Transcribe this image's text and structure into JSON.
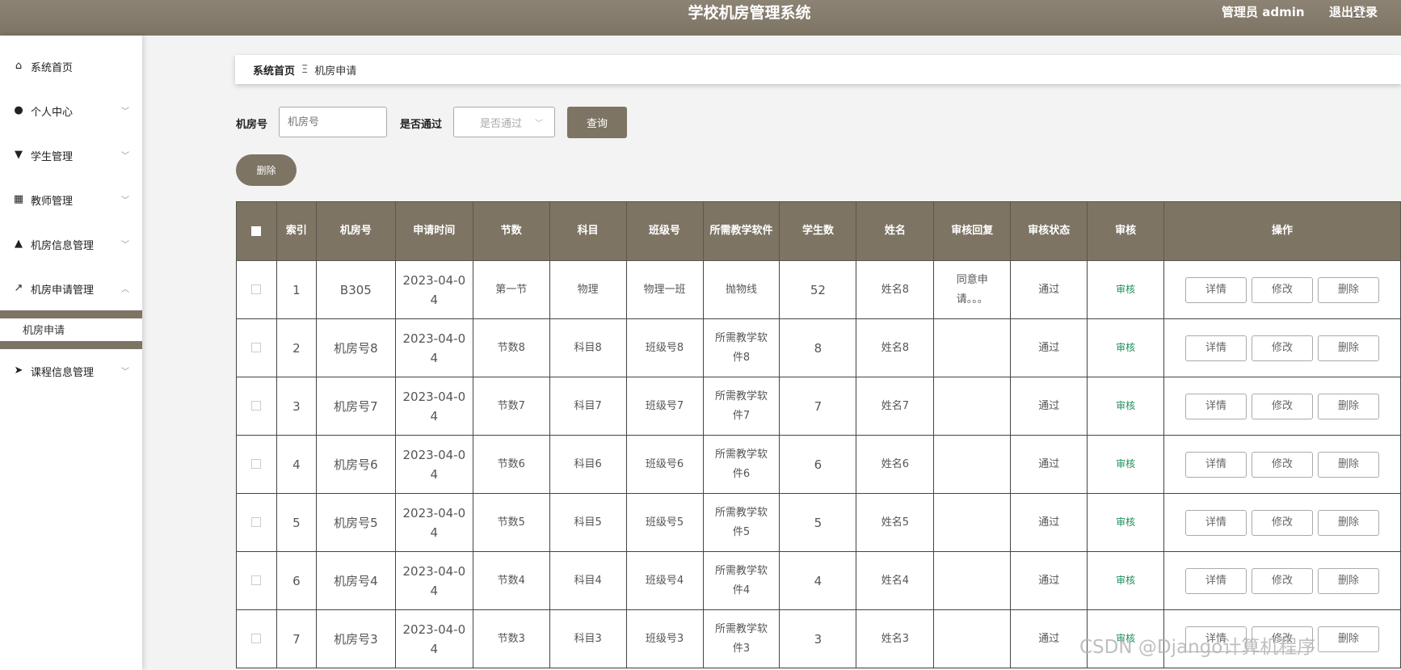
{
  "header": {
    "title": "学校机房管理系统",
    "user": "管理员 admin",
    "logout": "退出登录"
  },
  "sidebar": {
    "items": [
      {
        "label": "系统首页",
        "icon": "home-icon"
      },
      {
        "label": "个人中心",
        "icon": "user-icon"
      },
      {
        "label": "学生管理",
        "icon": "student-icon"
      },
      {
        "label": "教师管理",
        "icon": "grid-icon"
      },
      {
        "label": "机房信息管理",
        "icon": "person-icon"
      },
      {
        "label": "机房申请管理",
        "icon": "chart-icon"
      },
      {
        "label": "课程信息管理",
        "icon": "send-icon"
      }
    ],
    "active_sub": "机房申请"
  },
  "breadcrumb": {
    "home": "系统首页",
    "separator": "Ξ",
    "current": "机房申请"
  },
  "search": {
    "room_label": "机房号",
    "room_placeholder": "机房号",
    "pass_label": "是否通过",
    "pass_placeholder": "是否通过",
    "query_button": "查询"
  },
  "toolbar": {
    "delete_button": "删除"
  },
  "table": {
    "columns": [
      "索引",
      "机房号",
      "申请时间",
      "节数",
      "科目",
      "班级号",
      "所需教学软件",
      "学生数",
      "姓名",
      "审核回复",
      "审核状态",
      "审核",
      "操作"
    ],
    "rows": [
      {
        "index": "1",
        "room": "B305",
        "date_a": "2023-04-0",
        "date_b": "4",
        "session": "第一节",
        "subject": "物理",
        "class": "物理一班",
        "software_a": "抛物线",
        "software_b": "",
        "students": "52",
        "name": "姓名8",
        "reply_a": "同意申",
        "reply_b": "请。。。",
        "status": "通过",
        "audit": "审核"
      },
      {
        "index": "2",
        "room": "机房号8",
        "date_a": "2023-04-0",
        "date_b": "4",
        "session": "节数8",
        "subject": "科目8",
        "class": "班级号8",
        "software_a": "所需教学软",
        "software_b": "件8",
        "students": "8",
        "name": "姓名8",
        "reply_a": "",
        "reply_b": "",
        "status": "通过",
        "audit": "审核"
      },
      {
        "index": "3",
        "room": "机房号7",
        "date_a": "2023-04-0",
        "date_b": "4",
        "session": "节数7",
        "subject": "科目7",
        "class": "班级号7",
        "software_a": "所需教学软",
        "software_b": "件7",
        "students": "7",
        "name": "姓名7",
        "reply_a": "",
        "reply_b": "",
        "status": "通过",
        "audit": "审核"
      },
      {
        "index": "4",
        "room": "机房号6",
        "date_a": "2023-04-0",
        "date_b": "4",
        "session": "节数6",
        "subject": "科目6",
        "class": "班级号6",
        "software_a": "所需教学软",
        "software_b": "件6",
        "students": "6",
        "name": "姓名6",
        "reply_a": "",
        "reply_b": "",
        "status": "通过",
        "audit": "审核"
      },
      {
        "index": "5",
        "room": "机房号5",
        "date_a": "2023-04-0",
        "date_b": "4",
        "session": "节数5",
        "subject": "科目5",
        "class": "班级号5",
        "software_a": "所需教学软",
        "software_b": "件5",
        "students": "5",
        "name": "姓名5",
        "reply_a": "",
        "reply_b": "",
        "status": "通过",
        "audit": "审核"
      },
      {
        "index": "6",
        "room": "机房号4",
        "date_a": "2023-04-0",
        "date_b": "4",
        "session": "节数4",
        "subject": "科目4",
        "class": "班级号4",
        "software_a": "所需教学软",
        "software_b": "件4",
        "students": "4",
        "name": "姓名4",
        "reply_a": "",
        "reply_b": "",
        "status": "通过",
        "audit": "审核"
      },
      {
        "index": "7",
        "room": "机房号3",
        "date_a": "2023-04-0",
        "date_b": "4",
        "session": "节数3",
        "subject": "科目3",
        "class": "班级号3",
        "software_a": "所需教学软",
        "software_b": "件3",
        "students": "3",
        "name": "姓名3",
        "reply_a": "",
        "reply_b": "",
        "status": "通过",
        "audit": "审核"
      }
    ],
    "actions": {
      "detail": "详情",
      "edit": "修改",
      "delete": "删除"
    }
  },
  "watermark": "CSDN @Django计算机程序",
  "colors": {
    "primary": "#7d7464",
    "header": "#8c8374",
    "audit_link": "#1e8f5a"
  }
}
